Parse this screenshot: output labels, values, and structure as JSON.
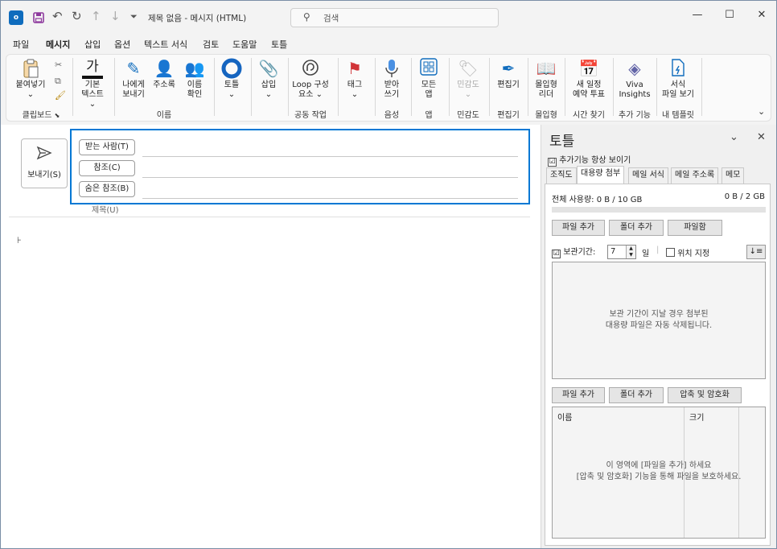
{
  "titlebar": {
    "app_icon_text": "o",
    "title": "제목 없음 - 메시지 (HTML)",
    "search_placeholder": "검색",
    "icons": [
      "outlook-app-icon",
      "save-icon",
      "undo-icon",
      "redo-icon",
      "up-arrow-icon",
      "down-arrow-icon",
      "customize-quick-access-icon"
    ],
    "controls": [
      "minimize",
      "maximize",
      "close"
    ]
  },
  "menus": [
    "파일",
    "메시지",
    "삽입",
    "옵션",
    "텍스트 서식",
    "검토",
    "도움말",
    "토틀"
  ],
  "active_menu": "메시지",
  "ribbon": {
    "paste": "붙여넣기",
    "paste_arrow": "⌄",
    "basic_text_1": "기본",
    "basic_text_2": "텍스트 ⌄",
    "send_to_me_1": "나에게",
    "send_to_me_2": "보내기",
    "address_book": "주소록",
    "check_names_1": "이름",
    "check_names_2": "확인",
    "totle": "토틀",
    "totle_arrow": "⌄",
    "attach": "삽입",
    "attach_arrow": "⌄",
    "loop_1": "Loop 구성",
    "loop_2": "요소 ⌄",
    "tag": "태그",
    "tag_arrow": "⌄",
    "dictate_1": "받아",
    "dictate_2": "쓰기",
    "all_apps_1": "모든",
    "all_apps_2": "앱",
    "sensitivity": "민감도",
    "sensitivity_arrow": "⌄",
    "editor": "편집기",
    "immersive_1": "몰입형",
    "immersive_2": "리더",
    "new_meeting_1": "새 일정",
    "new_meeting_2": "예약 투표",
    "viva_1": "Viva",
    "viva_2": "Insights",
    "template_1": "서식",
    "template_2": "파일 보기",
    "groups": {
      "clipboard": "클립보드",
      "names": "이름",
      "collab": "공동 작업",
      "voice": "음성",
      "apps": "앱",
      "sensitivity": "민감도",
      "editor": "편집기",
      "immersive": "몰입형",
      "time": "시간 찾기",
      "addins": "추가 기능",
      "templates": "내 템플릿"
    }
  },
  "compose": {
    "send_label": "보내기(S)",
    "to_label": "받는 사람(T)",
    "cc_label": "참조(C)",
    "bcc_label": "숨은 참조(B)",
    "subject_label": "제목(U)"
  },
  "panel": {
    "title": "토틀",
    "pin_checkbox": "☑",
    "pin_label": "추가기능 항상 보이기",
    "tabs": [
      "조직도",
      "대용량 첨부",
      "메일 서식",
      "메일 주소록",
      "메모"
    ],
    "active_tab": "대용량 첨부",
    "usage_total": "전체 사용량: 0 B / 10 GB",
    "usage_right": "0 B / 2 GB",
    "btn_add_file": "파일 추가",
    "btn_add_folder": "폴더 추가",
    "btn_outbox": "파일함",
    "retention_checkbox": "☑",
    "retention_label": "보관기간:",
    "retention_value": "7",
    "retention_unit": "일",
    "location_label": "위치 지정",
    "sort_icon": "↓≡",
    "retention_msg_1": "보관 기간이 지날 경우 첨부된",
    "retention_msg_2": "대용량 파일은 자동 삭제됩니다.",
    "btn_add_file2": "파일 추가",
    "btn_add_folder2": "폴더 추가",
    "btn_compress": "압축 및 암호화",
    "col_name": "이름",
    "col_size": "크기",
    "area_msg_1": "이 영역에 [파일을 추가] 하세요",
    "area_msg_2": "[압축 및 암호화] 기능을 통해 파일을 보호하세요."
  }
}
